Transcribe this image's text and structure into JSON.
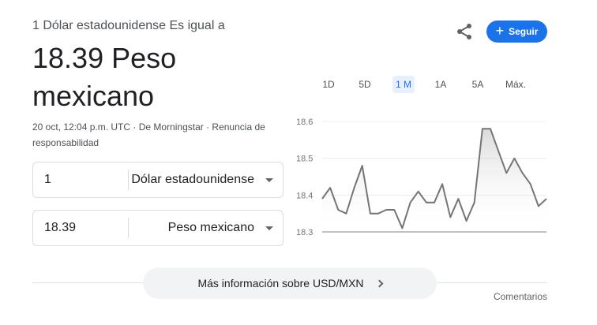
{
  "header": {
    "subtitle": "1 Dólar estadounidense Es igual a",
    "value_line1": "18.39 Peso",
    "value_line2": "mexicano",
    "meta_line1": "20 oct, 12:04 p.m. UTC · De Morningstar · Renuncia de",
    "meta_line2": "responsabilidad"
  },
  "actions": {
    "share_icon": "share-icon",
    "follow_label": "Seguir",
    "follow_icon": "+",
    "accent_color": "#1a73e8"
  },
  "converter": {
    "from": {
      "amount": "1",
      "currency": "Dólar estadounidense"
    },
    "to": {
      "amount": "18.39",
      "currency": "Peso mexicano"
    }
  },
  "ranges": {
    "items": [
      "1D",
      "5D",
      "1 M",
      "1A",
      "5A",
      "Máx."
    ],
    "active": "1 M"
  },
  "chart_data": {
    "type": "line",
    "yticks": [
      "18.6",
      "18.5",
      "18.4",
      "18.3"
    ],
    "ylim": [
      18.3,
      18.6
    ],
    "grid": true,
    "values": [
      18.39,
      18.42,
      18.36,
      18.35,
      18.42,
      18.48,
      18.35,
      18.35,
      18.36,
      18.36,
      18.31,
      18.38,
      18.41,
      18.38,
      18.38,
      18.43,
      18.34,
      18.39,
      18.33,
      18.38,
      18.58,
      18.58,
      18.52,
      18.46,
      18.5,
      18.46,
      18.43,
      18.37,
      18.39
    ],
    "line_color": "#757575"
  },
  "footer": {
    "more_label": "Más información sobre USD/MXN",
    "feedback_label": "Comentarios"
  }
}
